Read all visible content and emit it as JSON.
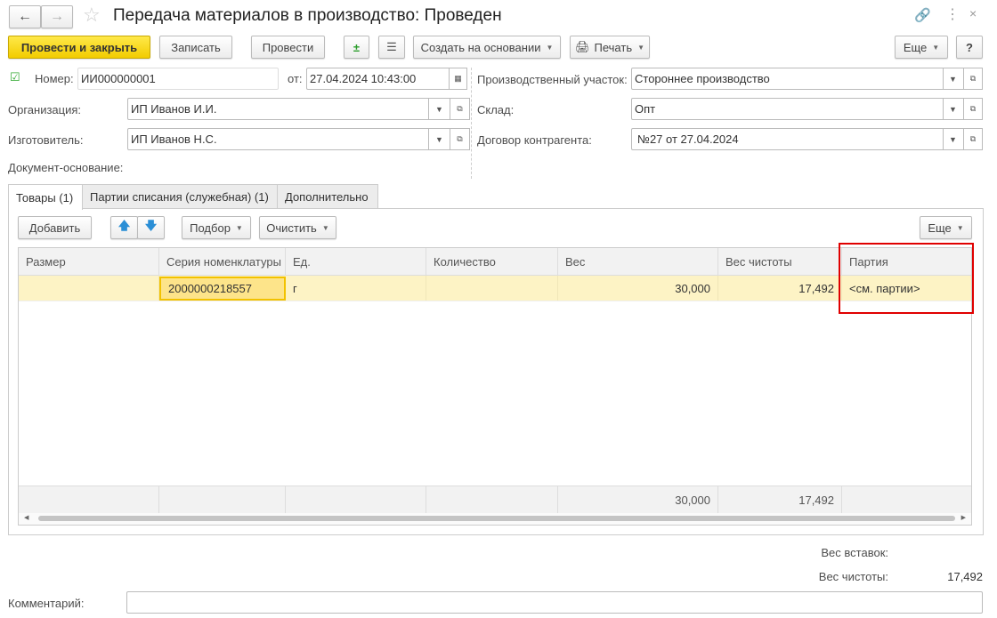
{
  "window": {
    "title": "Передача материалов в производство: Проведен"
  },
  "toolbar": {
    "post_close": "Провести и закрыть",
    "save": "Записать",
    "post": "Провести",
    "create_based": "Создать на основании",
    "print": "Печать",
    "more": "Еще",
    "help": "?"
  },
  "header": {
    "number_label": "Номер:",
    "number": "ИИ000000001",
    "date_label": "от:",
    "date": "27.04.2024 10:43:00",
    "org_label": "Организация:",
    "org": "ИП Иванов И.И.",
    "maker_label": "Изготовитель:",
    "maker": "ИП Иванов Н.С.",
    "basis_label": "Документ-основание:",
    "site_label": "Производственный участок:",
    "site": "Стороннее производство",
    "warehouse_label": "Склад:",
    "warehouse": "Опт",
    "contract_label": "Договор контрагента:",
    "contract": "№27 от 27.04.2024"
  },
  "tabs": [
    {
      "label": "Товары (1)",
      "active": true
    },
    {
      "label": "Партии списания (служебная) (1)"
    },
    {
      "label": "Дополнительно"
    }
  ],
  "table_toolbar": {
    "add": "Добавить",
    "pick": "Подбор",
    "clear": "Очистить",
    "more": "Еще"
  },
  "table": {
    "columns": [
      "Размер",
      "Серия номенклатуры",
      "Ед.",
      "Количество",
      "Вес",
      "Вес чистоты",
      "Партия"
    ],
    "rows": [
      [
        "",
        "2000000218557",
        "г",
        "",
        "30,000",
        "17,492",
        "<см. партии>"
      ]
    ],
    "totals": [
      "",
      "",
      "",
      "",
      "30,000",
      "17,492",
      ""
    ]
  },
  "footer": {
    "inserts_weight_label": "Вес вставок:",
    "inserts_weight": "",
    "purity_weight_label": "Вес чистоты:",
    "purity_weight": "17,492",
    "comment_label": "Комментарий:",
    "comment": ""
  },
  "colors": {
    "accent": "#f2cc00",
    "row_highlight": "#fdf3c5",
    "annotation": "#e00000"
  }
}
